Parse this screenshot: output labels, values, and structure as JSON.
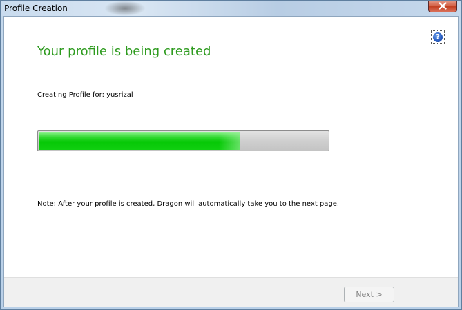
{
  "window": {
    "title": "Profile Creation"
  },
  "header": {
    "heading": "Your profile is being created"
  },
  "status": {
    "creating_label": "Creating Profile for:",
    "username": "yusrizal",
    "progress_fraction": 0.695
  },
  "note": {
    "text": "Note: After your profile is created, Dragon will automatically take you to the next page."
  },
  "footer": {
    "next_label": "Next >",
    "next_enabled": false
  },
  "icons": {
    "close": "close-icon",
    "help": "help-icon"
  },
  "colors": {
    "heading": "#2e9b1f",
    "progress_fill": "#06c806",
    "progress_track": "#cfcfcf",
    "help_blue": "#2a5fc4",
    "close_red": "#c33f20"
  }
}
